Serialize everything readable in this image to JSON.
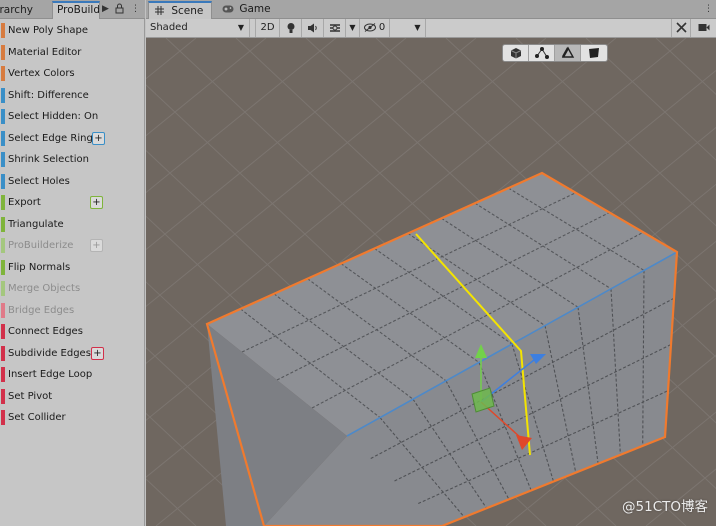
{
  "left_panel": {
    "tabs": {
      "hierarchy": "erarchy",
      "probuilder": "ProBuild"
    },
    "items": [
      {
        "label": "New Poly Shape",
        "color": "#d77b3f",
        "plus": false,
        "disabled": false
      },
      {
        "label": "Material Editor",
        "color": "#d77b3f",
        "plus": false,
        "disabled": false
      },
      {
        "label": "Vertex Colors",
        "color": "#d77b3f",
        "plus": false,
        "disabled": false
      },
      {
        "label": "Shift: Difference",
        "color": "#3a8fc7",
        "plus": false,
        "disabled": false
      },
      {
        "label": "Select Hidden: On",
        "color": "#3a8fc7",
        "plus": false,
        "disabled": false
      },
      {
        "label": "Select Edge Ring",
        "color": "#3a8fc7",
        "plus": true,
        "disabled": false
      },
      {
        "label": "Shrink Selection",
        "color": "#3a8fc7",
        "plus": false,
        "disabled": false
      },
      {
        "label": "Select Holes",
        "color": "#3a8fc7",
        "plus": false,
        "disabled": false
      },
      {
        "label": "Export",
        "color": "#7fb43b",
        "plus": true,
        "disabled": false
      },
      {
        "label": "Triangulate",
        "color": "#7fb43b",
        "plus": false,
        "disabled": false
      },
      {
        "label": "ProBuilderize",
        "color": "#a4c77e",
        "plus": true,
        "disabled": true
      },
      {
        "label": "Flip Normals",
        "color": "#7fb43b",
        "plus": false,
        "disabled": false
      },
      {
        "label": "Merge Objects",
        "color": "#a4c77e",
        "plus": false,
        "disabled": true
      },
      {
        "label": "Bridge Edges",
        "color": "#e07a88",
        "plus": false,
        "disabled": true
      },
      {
        "label": "Connect Edges",
        "color": "#d2304a",
        "plus": false,
        "disabled": false
      },
      {
        "label": "Subdivide Edges",
        "color": "#d2304a",
        "plus": true,
        "disabled": false
      },
      {
        "label": "Insert Edge Loop",
        "color": "#d2304a",
        "plus": false,
        "disabled": false
      },
      {
        "label": "Set Pivot",
        "color": "#d2304a",
        "plus": false,
        "disabled": false
      },
      {
        "label": "Set Collider",
        "color": "#d2304a",
        "plus": false,
        "disabled": false
      }
    ]
  },
  "scene_view": {
    "tabs": {
      "scene": "Scene",
      "game": "Game"
    },
    "toolbar": {
      "shading_mode": "Shaded",
      "mode_2d": "2D",
      "hidden_count": "0",
      "icons": [
        "lightbulb-icon",
        "speaker-icon",
        "effects-icon",
        "hidden-objects-icon",
        "tools-icon",
        "camera-icon"
      ]
    },
    "probuilder_modes": [
      "object-mode-icon",
      "vertex-mode-icon",
      "edge-mode-icon",
      "face-mode-icon"
    ],
    "selected_mode": "edge-mode-icon",
    "colors": {
      "background": "#6f6760",
      "mesh": "#8d8f94",
      "selection_outline": "#f07a2e",
      "selected_edge": "#f4e400"
    }
  },
  "watermark": "@51CTO博客"
}
